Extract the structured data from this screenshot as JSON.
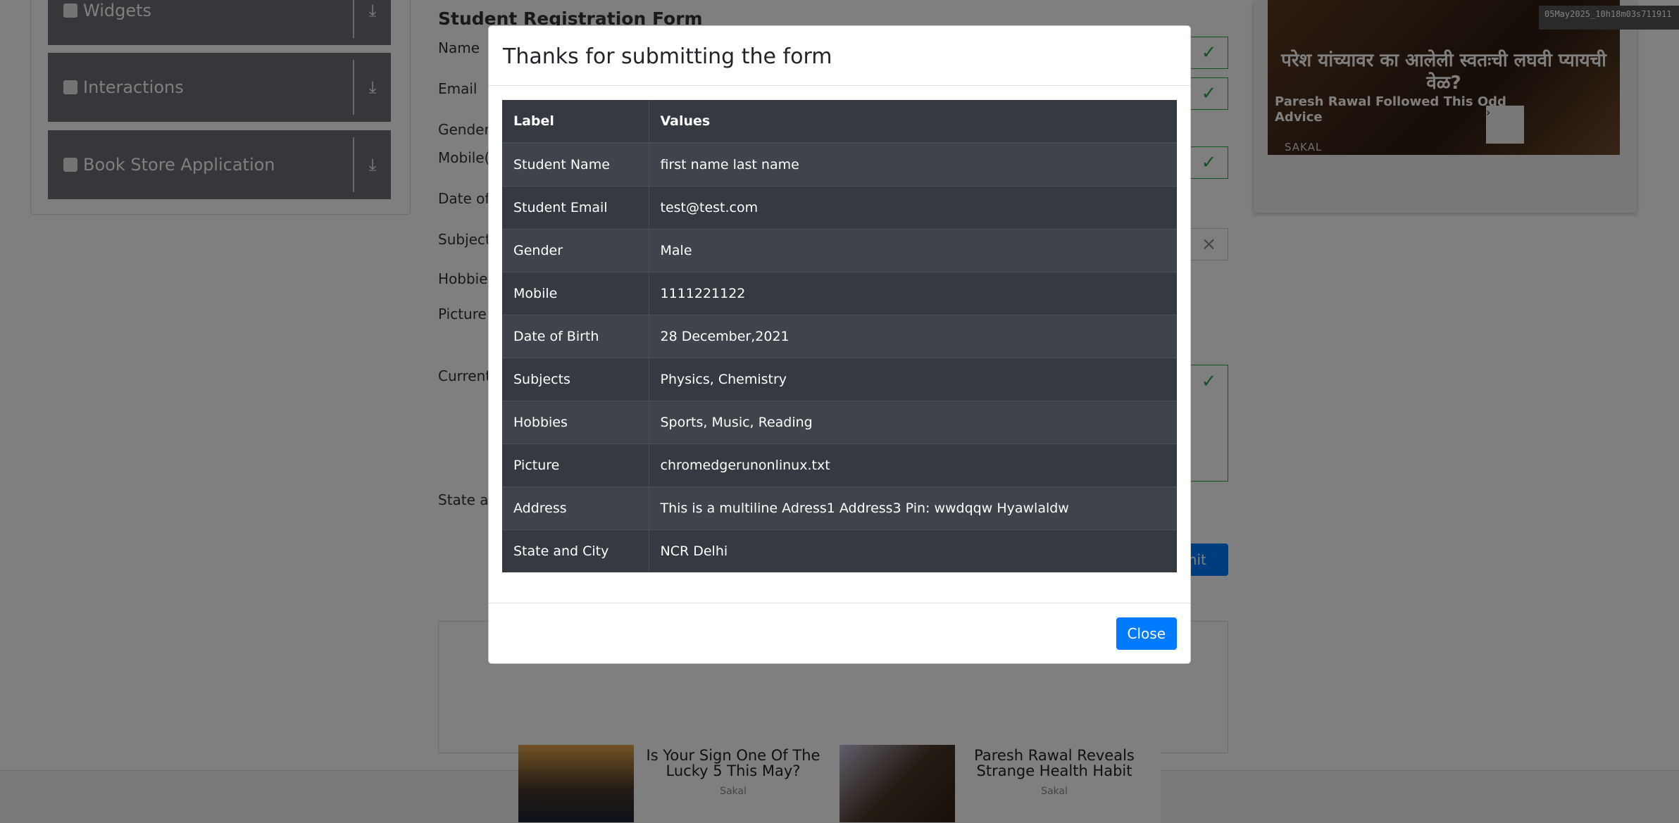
{
  "sidebar": {
    "groups": [
      {
        "label": "Widgets"
      },
      {
        "label": "Interactions"
      },
      {
        "label": "Book Store Application"
      }
    ]
  },
  "form": {
    "title": "Student Registration Form",
    "labels": [
      "Name",
      "Email",
      "Gender",
      "Mobile(",
      "Date of",
      "Subjects",
      "Hobbies",
      "Picture",
      "Current",
      "State an"
    ],
    "submit_fragment": "mit"
  },
  "ads": {
    "right": {
      "hindi_text": "परेश यांच्यावर का आलेली स्वतःची लघवी प्यायची वेळ?",
      "caption": "Paresh Rawal Followed This Odd Advice",
      "source": "SAKAL"
    },
    "stamp": "05May2025_10h18m03s711911",
    "bottom": [
      {
        "headline": "Is Your Sign One Of The Lucky 5 This May?",
        "source": "Sakal"
      },
      {
        "headline": "Paresh Rawal Reveals Strange Health Habit",
        "source": "Sakal"
      }
    ]
  },
  "modal": {
    "title": "Thanks for submitting the form",
    "columns": [
      "Label",
      "Values"
    ],
    "rows": [
      {
        "label": "Student Name",
        "value": "first name last name"
      },
      {
        "label": "Student Email",
        "value": "test@test.com"
      },
      {
        "label": "Gender",
        "value": "Male"
      },
      {
        "label": "Mobile",
        "value": "1111221122"
      },
      {
        "label": "Date of Birth",
        "value": "28 December,2021"
      },
      {
        "label": "Subjects",
        "value": "Physics, Chemistry"
      },
      {
        "label": "Hobbies",
        "value": "Sports, Music, Reading"
      },
      {
        "label": "Picture",
        "value": "chromedgerunonlinux.txt"
      },
      {
        "label": "Address",
        "value": "This is a multiline Adress1 Address3 Pin: wwdqqw Hyawlaldw"
      },
      {
        "label": "State and City",
        "value": "NCR Delhi"
      }
    ],
    "close_label": "Close"
  },
  "colors": {
    "primary": "#007bff",
    "table_dark": "#343a40",
    "valid_green": "#28a745"
  }
}
